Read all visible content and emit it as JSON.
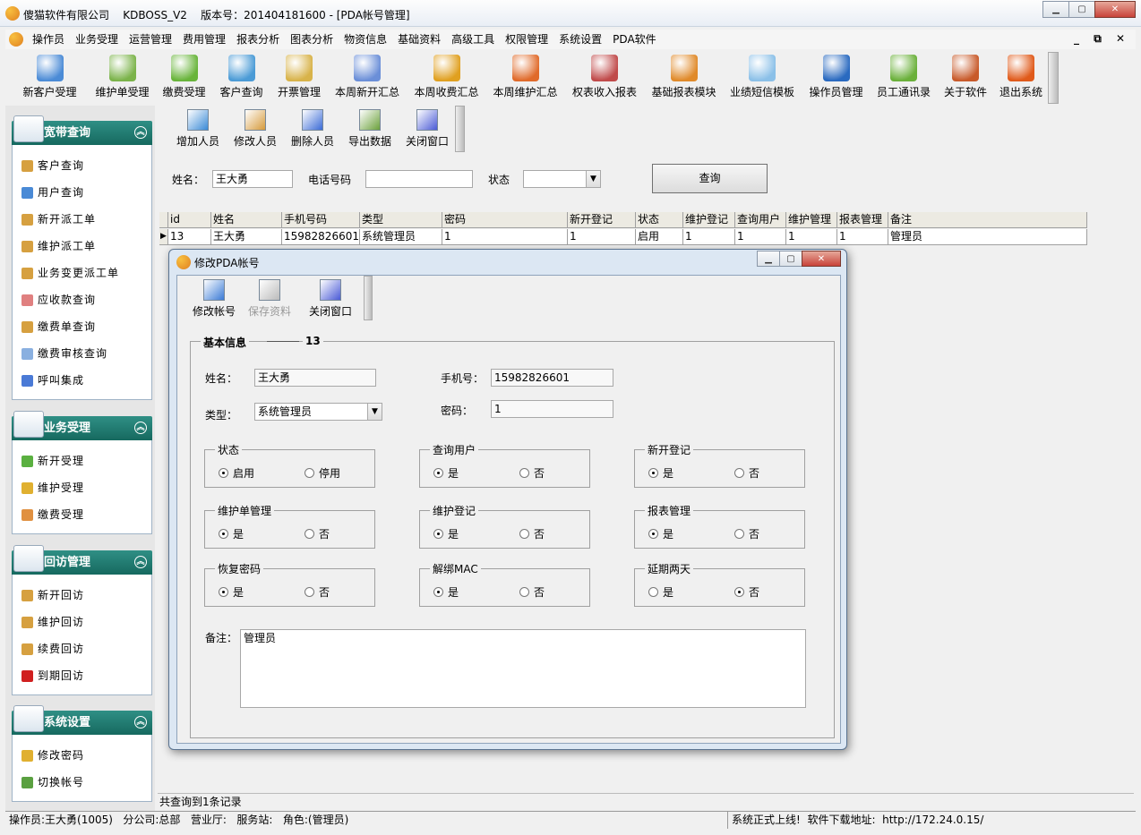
{
  "window": {
    "title": "傻猫软件有限公司    KDBOSS_V2    版本号：201404181600 - [PDA帐号管理]",
    "min": "▁",
    "max": "▢",
    "close": "✕"
  },
  "menu": [
    "操作员",
    "业务受理",
    "运营管理",
    "费用管理",
    "报表分析",
    "图表分析",
    "物资信息",
    "基础资料",
    "高级工具",
    "权限管理",
    "系统设置",
    "PDA软件"
  ],
  "mdi_controls": "_ ⧉ ✕",
  "toolbar": [
    {
      "label": "新客户受理",
      "color": "#4b8bd6"
    },
    {
      "label": "维护单受理",
      "color": "#7bb34a"
    },
    {
      "label": "缴费受理",
      "color": "#68b43a"
    },
    {
      "label": "客户查询",
      "color": "#4b9bd6"
    },
    {
      "label": "开票管理",
      "color": "#d8b34a"
    },
    {
      "label": "本周新开汇总",
      "color": "#6b8fd8"
    },
    {
      "label": "本周收费汇总",
      "color": "#e0a020"
    },
    {
      "label": "本周维护汇总",
      "color": "#e06a2a"
    },
    {
      "label": "权表收入报表",
      "color": "#c04a4a"
    },
    {
      "label": "基础报表模块",
      "color": "#e08a2a"
    },
    {
      "label": "业绩短信模板",
      "color": "#8bc0e8"
    },
    {
      "label": "操作员管理",
      "color": "#2a6ac0"
    },
    {
      "label": "员工通讯录",
      "color": "#6ab03a"
    },
    {
      "label": "关于软件",
      "color": "#c85a2a"
    },
    {
      "label": "退出系统",
      "color": "#e05a1a"
    }
  ],
  "left_groups": [
    {
      "title": "宽带查询",
      "items": [
        {
          "label": "客户查询",
          "color": "#d6a040"
        },
        {
          "label": "用户查询",
          "color": "#4a8ad6"
        },
        {
          "label": "新开派工单",
          "color": "#d6a040"
        },
        {
          "label": "维护派工单",
          "color": "#d6a040"
        },
        {
          "label": "业务变更派工单",
          "color": "#d6a040"
        },
        {
          "label": "应收款查询",
          "color": "#e08080"
        },
        {
          "label": "缴费单查询",
          "color": "#d6a040"
        },
        {
          "label": "缴费审核查询",
          "color": "#8ab0e0"
        },
        {
          "label": "呼叫集成",
          "color": "#4a7ad6"
        }
      ]
    },
    {
      "title": "业务受理",
      "items": [
        {
          "label": "新开受理",
          "color": "#5ab040"
        },
        {
          "label": "维护受理",
          "color": "#e0b030"
        },
        {
          "label": "缴费受理",
          "color": "#e09040"
        }
      ]
    },
    {
      "title": "回访管理",
      "items": [
        {
          "label": "新开回访",
          "color": "#d6a040"
        },
        {
          "label": "维护回访",
          "color": "#d6a040"
        },
        {
          "label": "续费回访",
          "color": "#d6a040"
        },
        {
          "label": "到期回访",
          "color": "#d02020"
        }
      ]
    },
    {
      "title": "系统设置",
      "items": [
        {
          "label": "修改密码",
          "color": "#e0b030"
        },
        {
          "label": "切换帐号",
          "color": "#5aa040"
        }
      ]
    }
  ],
  "sub_toolbar": [
    "增加人员",
    "修改人员",
    "删除人员",
    "导出数据",
    "关闭窗口"
  ],
  "search": {
    "name_label": "姓名：",
    "name_value": "王大勇",
    "phone_label": "电话号码",
    "phone_value": "",
    "status_label": "状态",
    "status_value": "",
    "query_button": "查询"
  },
  "grid": {
    "columns": [
      "id",
      "姓名",
      "手机号码",
      "类型",
      "密码",
      "新开登记",
      "状态",
      "维护登记",
      "查询用户",
      "维护管理",
      "报表管理",
      "备注"
    ],
    "rows": [
      [
        "13",
        "王大勇",
        "15982826601",
        "系统管理员",
        "1",
        "1",
        "启用",
        "1",
        "1",
        "1",
        "1",
        "管理员"
      ]
    ],
    "row_marker": "▶"
  },
  "result_text": "共查询到1条记录",
  "statusbar": {
    "left": "操作员:王大勇(1005)   分公司:总部   营业厅:   服务站:   角色:(管理员)",
    "right": "系统正式上线!  软件下载地址:  http://172.24.0.15/"
  },
  "dialog": {
    "title": "修改PDA帐号",
    "toolbar": [
      "修改帐号",
      "保存资料",
      "关闭窗口"
    ],
    "section": "基本信息",
    "record_id": "13",
    "name_label": "姓名：",
    "name_value": "王大勇",
    "phone_label": "手机号：",
    "phone_value": "15982826601",
    "type_label": "类型：",
    "type_value": "系统管理员",
    "pwd_label": "密码：",
    "pwd_value": "1",
    "remark_label": "备注：",
    "remark_value": "管理员",
    "groups": [
      {
        "title": "状态",
        "opt1": "启用",
        "opt2": "停用",
        "selected": 1
      },
      {
        "title": "查询用户",
        "opt1": "是",
        "opt2": "否",
        "selected": 1
      },
      {
        "title": "新开登记",
        "opt1": "是",
        "opt2": "否",
        "selected": 1
      },
      {
        "title": "维护单管理",
        "opt1": "是",
        "opt2": "否",
        "selected": 1
      },
      {
        "title": "维护登记",
        "opt1": "是",
        "opt2": "否",
        "selected": 1
      },
      {
        "title": "报表管理",
        "opt1": "是",
        "opt2": "否",
        "selected": 1
      },
      {
        "title": "恢复密码",
        "opt1": "是",
        "opt2": "否",
        "selected": 1
      },
      {
        "title": "解绑MAC",
        "opt1": "是",
        "opt2": "否",
        "selected": 1
      },
      {
        "title": "延期两天",
        "opt1": "是",
        "opt2": "否",
        "selected": 2
      }
    ]
  }
}
